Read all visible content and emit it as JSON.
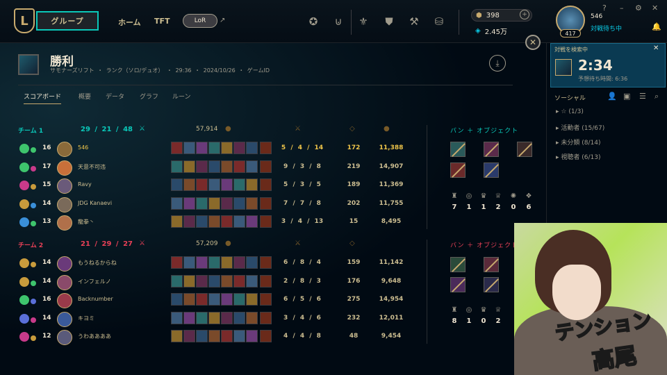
{
  "topbar": {
    "logo": "L",
    "play_label": "グループ",
    "nav": [
      "ホーム",
      "TFT"
    ],
    "lor_label": "LoR",
    "ext_icon": "↗",
    "blue_essence": "398",
    "rp": "2.45万",
    "summoner_level": "417",
    "summoner_name": "546",
    "status": "対戦待ち中"
  },
  "result": {
    "title": "勝利",
    "meta": "サモナーズリフト ・ ランク（ソロ/デュオ） ・ 29:36 ・ 2024/10/26 ・ ゲームID"
  },
  "tabs": [
    "スコアボード",
    "概要",
    "データ",
    "グラフ",
    "ルーン"
  ],
  "team1": {
    "label": "チーム 1",
    "kda": "29 / 21 / 48",
    "gold": "57,914",
    "ban_label": "バン ＋ オブジェクト",
    "objectives": [
      "7",
      "1",
      "1",
      "2",
      "0",
      "6"
    ],
    "players": [
      {
        "level": "16",
        "name": "546",
        "kda": "5 / 4 / 14",
        "cs": "172",
        "gold": "11,388"
      },
      {
        "level": "17",
        "name": "天意不可违",
        "kda": "9 / 3 / 8",
        "cs": "219",
        "gold": "14,907"
      },
      {
        "level": "15",
        "name": "Ravy",
        "kda": "5 / 3 / 5",
        "cs": "189",
        "gold": "11,369"
      },
      {
        "level": "14",
        "name": "JDG Kanaevi",
        "kda": "7 / 7 / 8",
        "cs": "202",
        "gold": "11,755"
      },
      {
        "level": "13",
        "name": "龍拳丶",
        "kda": "3 / 4 / 13",
        "cs": "15",
        "gold": "8,495"
      }
    ]
  },
  "team2": {
    "label": "チーム 2",
    "kda": "21 / 29 / 27",
    "gold": "57,209",
    "ban_label": "バン ＋ オブジェクト",
    "objectives": [
      "8",
      "1",
      "0",
      "2"
    ],
    "players": [
      {
        "level": "14",
        "name": "もうねるからね",
        "kda": "6 / 8 / 4",
        "cs": "159",
        "gold": "11,142"
      },
      {
        "level": "14",
        "name": "インフェルノ",
        "kda": "2 / 8 / 3",
        "cs": "176",
        "gold": "9,648"
      },
      {
        "level": "16",
        "name": "Backnumber",
        "kda": "6 / 5 / 6",
        "cs": "275",
        "gold": "14,954"
      },
      {
        "level": "14",
        "name": "キヨミ",
        "kda": "3 / 4 / 6",
        "cs": "232",
        "gold": "12,011"
      },
      {
        "level": "12",
        "name": "うわああああ",
        "kda": "4 / 4 / 8",
        "cs": "48",
        "gold": "9,454"
      }
    ]
  },
  "queue": {
    "label": "対戦を検索中",
    "time": "2:34",
    "estimate": "予想待ち時間: 6:36"
  },
  "social": {
    "title": "ソーシャル",
    "groups": [
      "☆ (1/3)",
      "活動者 (15/67)",
      "未分類 (8/14)",
      "視聴者 (6/13)"
    ]
  },
  "stream_overlay": {
    "line1": "テンション",
    "line2": "高尾"
  },
  "colors": {
    "accent_teal": "#0ac8b9",
    "gold": "#c8aa6e",
    "red": "#e84057",
    "highlight": "#f0c64a"
  }
}
